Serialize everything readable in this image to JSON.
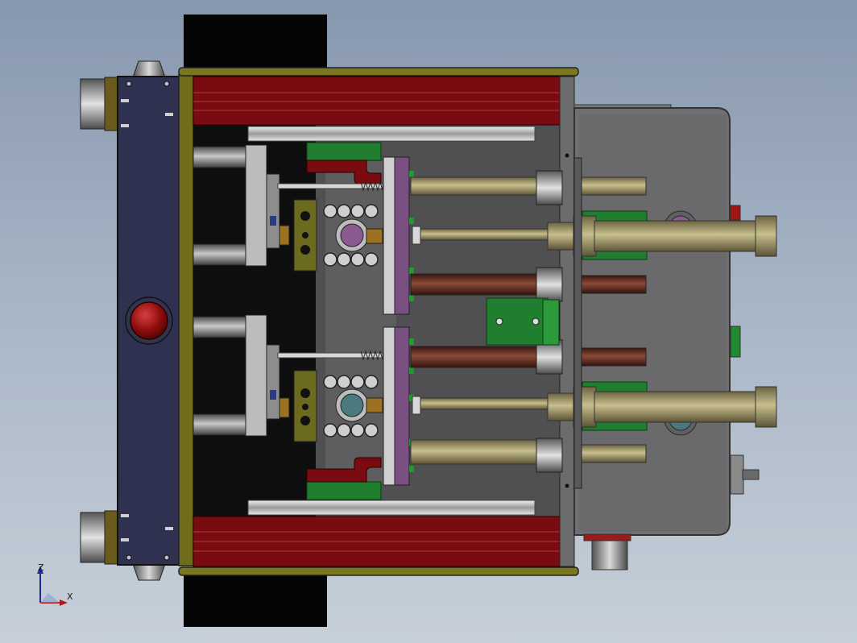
{
  "triad": {
    "axis_z_label": "Z",
    "axis_x_label": "X"
  },
  "colors": {
    "background_top": "#8797ae",
    "background_bottom": "#c7d0d9",
    "dark_red_panel": "#7a0b10",
    "navy_plate": "#2b2f4a",
    "olive_frame": "#6b6a1e",
    "steel_grey": "#6e6e70",
    "green_block": "#1f7f2e",
    "purple_plate": "#7a4f82",
    "brass_rod": "#8f8456",
    "brown_rod": "#5a2a1e",
    "red_button": "#9c0d0d"
  },
  "icons": {
    "red_button": "circle-button-icon",
    "axis_triad": "coordinate-axis-icon"
  }
}
